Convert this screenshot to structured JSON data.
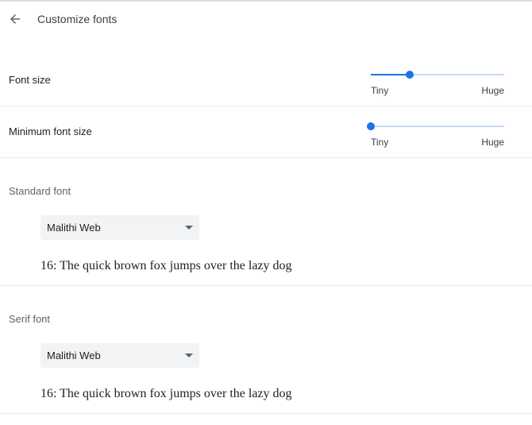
{
  "header": {
    "title": "Customize fonts",
    "back_icon": "arrow-left-icon"
  },
  "font_size": {
    "label": "Font size",
    "min_label": "Tiny",
    "max_label": "Huge",
    "value_fraction": 0.29
  },
  "minimum_font_size": {
    "label": "Minimum font size",
    "min_label": "Tiny",
    "max_label": "Huge",
    "value_fraction": 0.0
  },
  "standard_font": {
    "title": "Standard font",
    "selected": "Malithi Web",
    "sample": "16: The quick brown fox jumps over the lazy dog"
  },
  "serif_font": {
    "title": "Serif font",
    "selected": "Malithi Web",
    "sample": "16: The quick brown fox jumps over the lazy dog"
  },
  "colors": {
    "accent": "#1a73e8",
    "track": "#c6dafc",
    "select_bg": "#f1f3f4",
    "divider": "#e8eaed"
  }
}
